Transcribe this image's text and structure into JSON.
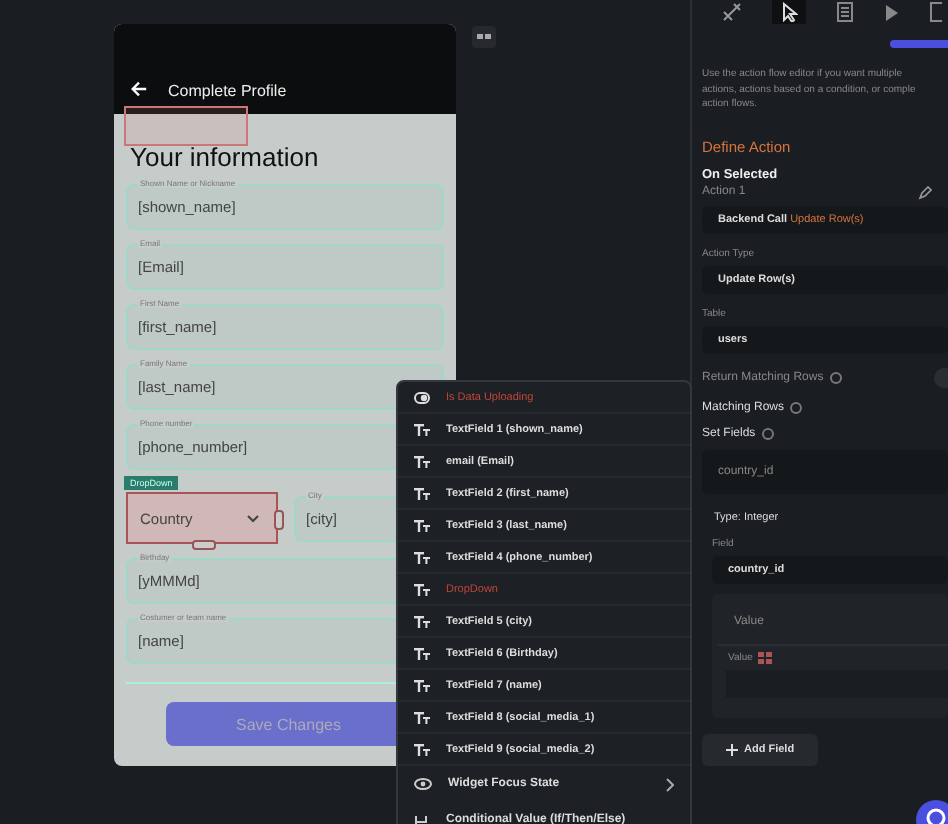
{
  "phone": {
    "title": "Complete Profile",
    "heading": "Your information",
    "fields": [
      {
        "label": "Shown Name or Nickname",
        "value": "[shown_name]"
      },
      {
        "label": "Email",
        "value": "[Email]"
      },
      {
        "label": "First Name",
        "value": "[first_name]"
      },
      {
        "label": "Family Name",
        "value": "[last_name]"
      },
      {
        "label": "Phone number",
        "value": "[phone_number]"
      }
    ],
    "dropdown": {
      "tag": "DropDown",
      "value": "Country"
    },
    "city": {
      "label": "City",
      "value": "[city]"
    },
    "more_fields": [
      {
        "label": "Birthday",
        "value": "[yMMMd]"
      },
      {
        "label": "Costumer or team name",
        "value": "[name]"
      }
    ],
    "button": "Save Changes"
  },
  "menu": {
    "items": [
      {
        "kind": "toggle",
        "label": "Is Data Uploading",
        "warning": true
      },
      {
        "kind": "text",
        "label": "TextField 1 (shown_name)",
        "warning": false
      },
      {
        "kind": "text",
        "label": "email (Email)",
        "warning": false
      },
      {
        "kind": "text",
        "label": "TextField 2 (first_name)",
        "warning": false
      },
      {
        "kind": "text",
        "label": "TextField 3 (last_name)",
        "warning": false
      },
      {
        "kind": "text",
        "label": "TextField 4 (phone_number)",
        "warning": false
      },
      {
        "kind": "text",
        "label": "DropDown",
        "warning": true
      },
      {
        "kind": "text",
        "label": "TextField 5 (city)",
        "warning": false
      },
      {
        "kind": "text",
        "label": "TextField 6 (Birthday)",
        "warning": false
      },
      {
        "kind": "text",
        "label": "TextField 7 (name)",
        "warning": false
      },
      {
        "kind": "text",
        "label": "TextField 8 (social_media_1)",
        "warning": false
      },
      {
        "kind": "text",
        "label": "TextField 9 (social_media_2)",
        "warning": false
      }
    ],
    "submenu": "Widget Focus State",
    "last": "Conditional Value (If/Then/Else)"
  },
  "panel": {
    "hint_lines": [
      "Use the action flow editor if you want multiple",
      "actions, actions based on a condition, or comple",
      "action flows."
    ],
    "section": "Define Action",
    "trigger": "On Selected",
    "action": "Action 1",
    "call": {
      "label": "Backend Call",
      "detail": "Update Row(s)"
    },
    "action_type": {
      "label": "Action Type",
      "value": "Update Row(s)"
    },
    "table": {
      "label": "Table",
      "value": "users"
    },
    "return_rows": {
      "label": "Return Matching Rows",
      "on": false
    },
    "matching": "Matching Rows",
    "set_fields": "Set Fields",
    "field_select": "country_id",
    "type": "Type: Integer",
    "field": {
      "label": "Field",
      "value": "country_id"
    },
    "value_select": "Value",
    "value_label": "Value",
    "add": "Add Field"
  }
}
